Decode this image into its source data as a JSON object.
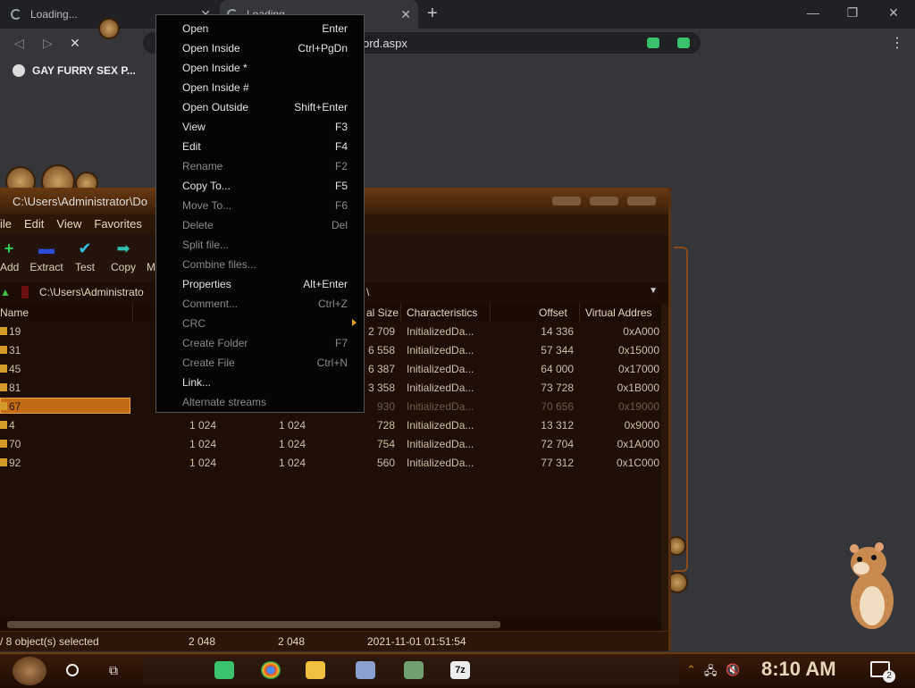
{
  "browser": {
    "tabs": [
      {
        "title": "Loading..."
      },
      {
        "title": "Loading..."
      }
    ],
    "new_tab_label": "+",
    "omnibox_url_tail": "ord.aspx",
    "bookmarks": [
      {
        "label": "GAY FURRY SEX P..."
      }
    ]
  },
  "sevenzip": {
    "title": "C:\\Users\\Administrator\\Do",
    "menu": [
      "ile",
      "Edit",
      "View",
      "Favorites"
    ],
    "toolbar": [
      {
        "label": "Add",
        "icon": "plus-icon"
      },
      {
        "label": "Extract",
        "icon": "minus-icon"
      },
      {
        "label": "Test",
        "icon": "checkmark-icon"
      },
      {
        "label": "Copy",
        "icon": "arrow-right-icon"
      },
      {
        "label": "M",
        "icon": "move-icon"
      }
    ],
    "path": "C:\\Users\\Administrato",
    "path_tail": "\\",
    "columns": [
      "Name",
      "al Size",
      "Characteristics",
      "Offset",
      "Virtual Addres"
    ],
    "rows": [
      {
        "name": "19",
        "size1": "",
        "size2": "",
        "vsize": "2 709",
        "chars": "InitializedDa...",
        "offset": "14 336",
        "vaddr": "0xA000"
      },
      {
        "name": "31",
        "size1": "",
        "size2": "",
        "vsize": "6 558",
        "chars": "InitializedDa...",
        "offset": "57 344",
        "vaddr": "0x15000"
      },
      {
        "name": "45",
        "size1": "",
        "size2": "",
        "vsize": "6 387",
        "chars": "InitializedDa...",
        "offset": "64 000",
        "vaddr": "0x17000"
      },
      {
        "name": "81",
        "size1": "",
        "size2": "",
        "vsize": "3 358",
        "chars": "InitializedDa...",
        "offset": "73 728",
        "vaddr": "0x1B000"
      },
      {
        "name": "67",
        "size1": "",
        "size2": "",
        "vsize": "930",
        "chars": "InitializedDa...",
        "offset": "70 656",
        "vaddr": "0x19000"
      },
      {
        "name": "4",
        "size1": "1 024",
        "size2": "1 024",
        "vsize": "728",
        "chars": "InitializedDa...",
        "offset": "13 312",
        "vaddr": "0x9000"
      },
      {
        "name": "70",
        "size1": "1 024",
        "size2": "1 024",
        "vsize": "754",
        "chars": "InitializedDa...",
        "offset": "72 704",
        "vaddr": "0x1A000"
      },
      {
        "name": "92",
        "size1": "1 024",
        "size2": "1 024",
        "vsize": "560",
        "chars": "InitializedDa...",
        "offset": "77 312",
        "vaddr": "0x1C000"
      }
    ],
    "status": {
      "selected": "/ 8 object(s) selected",
      "size1": "2 048",
      "size2": "2 048",
      "modified": "2021-11-01 01:51:54"
    }
  },
  "context_menu": {
    "items": [
      {
        "label": "Open",
        "key": "Enter",
        "enabled": true
      },
      {
        "label": "Open Inside",
        "key": "Ctrl+PgDn",
        "enabled": true
      },
      {
        "label": "Open Inside *",
        "key": "",
        "enabled": true
      },
      {
        "label": "Open Inside #",
        "key": "",
        "enabled": true
      },
      {
        "label": "Open Outside",
        "key": "Shift+Enter",
        "enabled": true
      },
      {
        "label": "View",
        "key": "F3",
        "enabled": true
      },
      {
        "label": "Edit",
        "key": "F4",
        "enabled": true
      },
      {
        "label": "Rename",
        "key": "F2",
        "enabled": false
      },
      {
        "label": "Copy To...",
        "key": "F5",
        "enabled": true
      },
      {
        "label": "Move To...",
        "key": "F6",
        "enabled": false
      },
      {
        "label": "Delete",
        "key": "Del",
        "enabled": false
      },
      {
        "label": "Split file...",
        "key": "",
        "enabled": false
      },
      {
        "label": "Combine files...",
        "key": "",
        "enabled": false
      },
      {
        "label": "Properties",
        "key": "Alt+Enter",
        "enabled": true
      },
      {
        "label": "Comment...",
        "key": "Ctrl+Z",
        "enabled": false
      },
      {
        "label": "CRC",
        "key": "",
        "enabled": false,
        "submenu": true
      },
      {
        "label": "Create Folder",
        "key": "F7",
        "enabled": false
      },
      {
        "label": "Create File",
        "key": "Ctrl+N",
        "enabled": false
      },
      {
        "label": "Link...",
        "key": "",
        "enabled": true
      },
      {
        "label": "Alternate streams",
        "key": "",
        "enabled": false
      }
    ]
  },
  "taskbar": {
    "clock": "8:10 AM",
    "notification_count": "2",
    "icons": [
      "green-note-icon",
      "chrome-icon",
      "folder-icon",
      "keyboard-icon",
      "tray-app-icon",
      "7zip-icon"
    ]
  },
  "colors": {
    "accent": "#c36a14",
    "menu_bg": "#050505",
    "window_bg": "#1e0f06"
  }
}
